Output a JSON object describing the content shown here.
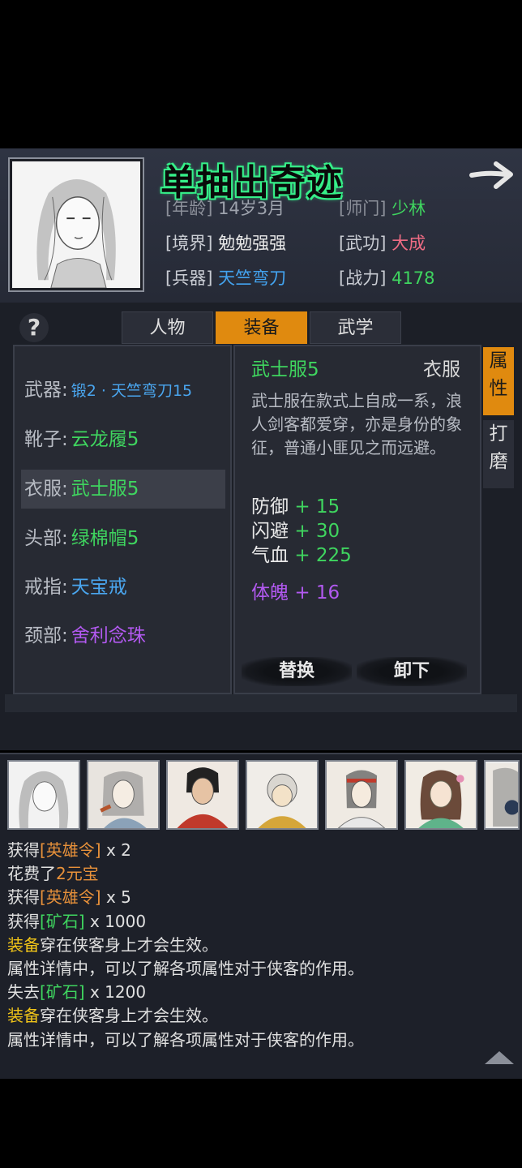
{
  "banner": "单抽出奇迹",
  "info": {
    "age_label": "[年龄]",
    "age_value": "14岁3月",
    "sect_label": "[师门]",
    "sect_value": "少林",
    "realm_label": "[境界]",
    "realm_value": "勉勉强强",
    "martial_label": "[武功]",
    "martial_value": "大成",
    "weapon_label": "[兵器]",
    "weapon_value": "天竺弯刀",
    "power_label": "[战力]",
    "power_value": "4178"
  },
  "help": "?",
  "tabs": [
    "人物",
    "装备",
    "武学"
  ],
  "equipment": [
    {
      "slot": "武器:",
      "item": "锻2 · 天竺弯刀15",
      "color": "#4aa6ef"
    },
    {
      "slot": "靴子:",
      "item": "云龙履5",
      "color": "#3fd55f"
    },
    {
      "slot": "衣服:",
      "item": "武士服5",
      "color": "#3fd55f"
    },
    {
      "slot": "头部:",
      "item": "绿棉帽5",
      "color": "#3fd55f"
    },
    {
      "slot": "戒指:",
      "item": "天宝戒",
      "color": "#4aa6ef"
    },
    {
      "slot": "颈部:",
      "item": "舍利念珠",
      "color": "#b259f0"
    }
  ],
  "detail": {
    "name": "武士服5",
    "type": "衣服",
    "description": "武士服在款式上自成一系，浪人剑客都爱穿，亦是身份的象征，普通小匪见之而远避。",
    "stats": [
      {
        "name": "防御",
        "plus": "+",
        "value": "15"
      },
      {
        "name": "闪避",
        "plus": "+",
        "value": "30"
      },
      {
        "name": "气血",
        "plus": "+",
        "value": "225"
      }
    ],
    "special_stat": {
      "name": "体魄",
      "plus": "+",
      "value": "16"
    },
    "replace_button": "替换",
    "unequip_button": "卸下"
  },
  "side_tabs": {
    "attributes": [
      "属",
      "性"
    ],
    "forge": [
      "打",
      "磨"
    ]
  },
  "log": [
    {
      "parts": [
        {
          "t": "获得",
          "c": ""
        },
        {
          "t": "[英雄令]",
          "c": "orange"
        },
        {
          "t": " x 2",
          "c": ""
        }
      ]
    },
    {
      "parts": [
        {
          "t": "花费了",
          "c": ""
        },
        {
          "t": "2元宝",
          "c": "orange"
        }
      ]
    },
    {
      "parts": [
        {
          "t": "获得",
          "c": ""
        },
        {
          "t": "[英雄令]",
          "c": "orange"
        },
        {
          "t": " x 5",
          "c": ""
        }
      ]
    },
    {
      "parts": [
        {
          "t": "获得",
          "c": ""
        },
        {
          "t": "[矿石]",
          "c": "green"
        },
        {
          "t": " x 1000",
          "c": ""
        }
      ]
    },
    {
      "parts": [
        {
          "t": "装备",
          "c": "yellow"
        },
        {
          "t": "穿在侠客身上才会生效。",
          "c": ""
        }
      ]
    },
    {
      "parts": [
        {
          "t": "属性详情中，可以了解各项属性对于侠客的作用。",
          "c": ""
        }
      ]
    },
    {
      "parts": [
        {
          "t": "失去",
          "c": ""
        },
        {
          "t": "[矿石]",
          "c": "green"
        },
        {
          "t": " x 1200",
          "c": ""
        }
      ]
    },
    {
      "parts": [
        {
          "t": "装备",
          "c": "yellow"
        },
        {
          "t": "穿在侠客身上才会生效。",
          "c": ""
        }
      ]
    },
    {
      "parts": [
        {
          "t": "属性详情中，可以了解各项属性对于侠客的作用。",
          "c": ""
        }
      ]
    }
  ]
}
